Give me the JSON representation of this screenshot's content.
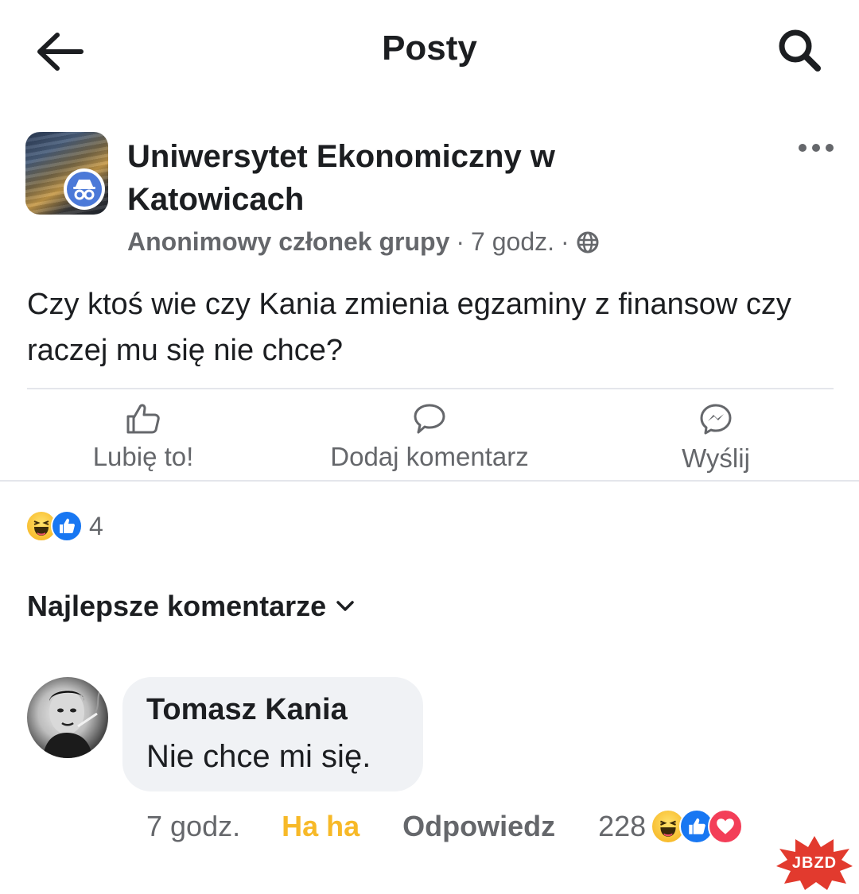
{
  "header": {
    "title": "Posty",
    "back_icon": "arrow-left-icon",
    "search_icon": "search-icon"
  },
  "post": {
    "group_name": "Uniwersytet Ekonomiczny w Katowicach",
    "author": "Anonimowy członek grupy",
    "time": "7 godz.",
    "separator": "·",
    "privacy_icon": "globe-icon",
    "text": "Czy ktoś wie czy Kania zmienia egzaminy z finansow czy raczej mu się nie chce?",
    "more_icon": "more-horizontal-icon"
  },
  "actions": {
    "like_label": "Lubię to!",
    "comment_label": "Dodaj komentarz",
    "send_label": "Wyślij"
  },
  "reactions": {
    "count": "4",
    "types": [
      "haha",
      "like"
    ]
  },
  "comments_sort": {
    "label": "Najlepsze komentarze"
  },
  "comment": {
    "author": "Tomasz Kania",
    "text": "Nie chce mi się.",
    "time": "7 godz.",
    "reaction_label": "Ha ha",
    "reply_label": "Odpowiedz",
    "reaction_count": "228",
    "reaction_types": [
      "haha",
      "like",
      "love"
    ]
  },
  "watermark": {
    "text": "JBZD"
  },
  "colors": {
    "text_primary": "#1c1e21",
    "text_secondary": "#65676b",
    "haha_yellow": "#f7b928",
    "like_blue": "#1877f2",
    "love_red": "#f33e58",
    "bubble_bg": "#f0f2f5",
    "divider": "#e4e6eb"
  }
}
